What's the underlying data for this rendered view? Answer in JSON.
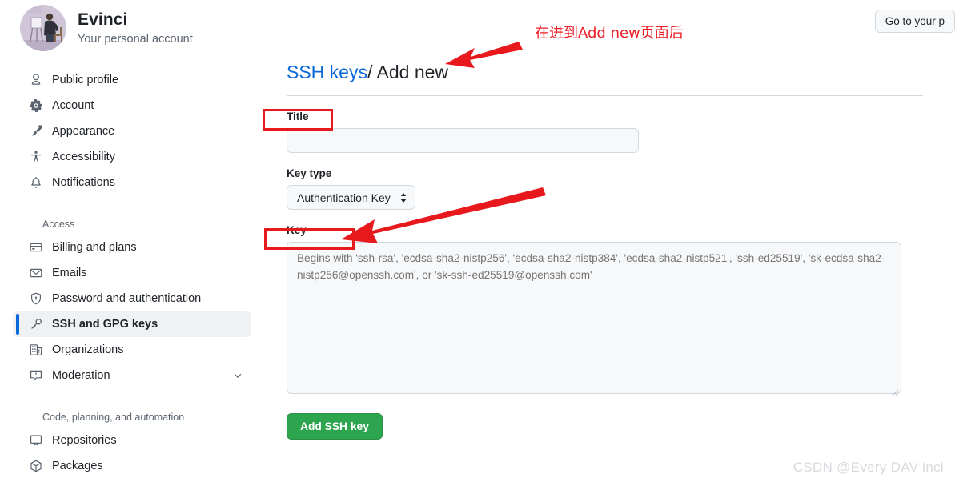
{
  "sidebar": {
    "profile": {
      "name": "Evinci",
      "subtitle": "Your personal account",
      "avatar_icon": "user-avatar-photo"
    },
    "primary_items": [
      {
        "label": "Public profile",
        "icon": "person-icon",
        "selected": false
      },
      {
        "label": "Account",
        "icon": "gear-icon",
        "selected": false
      },
      {
        "label": "Appearance",
        "icon": "paintbrush-icon",
        "selected": false
      },
      {
        "label": "Accessibility",
        "icon": "accessibility-icon",
        "selected": false
      },
      {
        "label": "Notifications",
        "icon": "bell-icon",
        "selected": false
      }
    ],
    "access_group": {
      "title": "Access",
      "items": [
        {
          "label": "Billing and plans",
          "icon": "credit-card-icon",
          "selected": false,
          "chevron": false
        },
        {
          "label": "Emails",
          "icon": "mail-icon",
          "selected": false,
          "chevron": false
        },
        {
          "label": "Password and authentication",
          "icon": "shield-lock-icon",
          "selected": false,
          "chevron": false
        },
        {
          "label": "SSH and GPG keys",
          "icon": "key-icon",
          "selected": true,
          "chevron": false
        },
        {
          "label": "Organizations",
          "icon": "organization-icon",
          "selected": false,
          "chevron": false
        },
        {
          "label": "Moderation",
          "icon": "report-icon",
          "selected": false,
          "chevron": true
        }
      ]
    },
    "code_group": {
      "title": "Code, planning, and automation",
      "items": [
        {
          "label": "Repositories",
          "icon": "repo-icon",
          "selected": false,
          "chevron": false
        },
        {
          "label": "Packages",
          "icon": "package-icon",
          "selected": false,
          "chevron": false
        }
      ]
    }
  },
  "topbar": {
    "profile_button": "Go to your p"
  },
  "main": {
    "breadcrumb": {
      "link": "SSH keys",
      "separator": "/",
      "current": "Add new"
    },
    "title_field": {
      "label": "Title",
      "value": "",
      "placeholder": ""
    },
    "key_type_field": {
      "label": "Key type",
      "selected": "Authentication Key"
    },
    "key_field": {
      "label": "Key",
      "value": "",
      "placeholder": "Begins with 'ssh-rsa', 'ecdsa-sha2-nistp256', 'ecdsa-sha2-nistp384', 'ecdsa-sha2-nistp521', 'ssh-ed25519', 'sk-ecdsa-sha2-nistp256@openssh.com', or 'sk-ssh-ed25519@openssh.com'"
    },
    "submit_label": "Add SSH key"
  },
  "annotations": {
    "note_text": "在进到Add new页面后",
    "accent_color": "#e8191c",
    "arrow_to_heading": "arrow-icon",
    "arrow_to_key_label": "arrow-icon",
    "box_title": "highlight-box",
    "box_key": "highlight-box"
  },
  "watermark": "CSDN @Every DAV inci"
}
